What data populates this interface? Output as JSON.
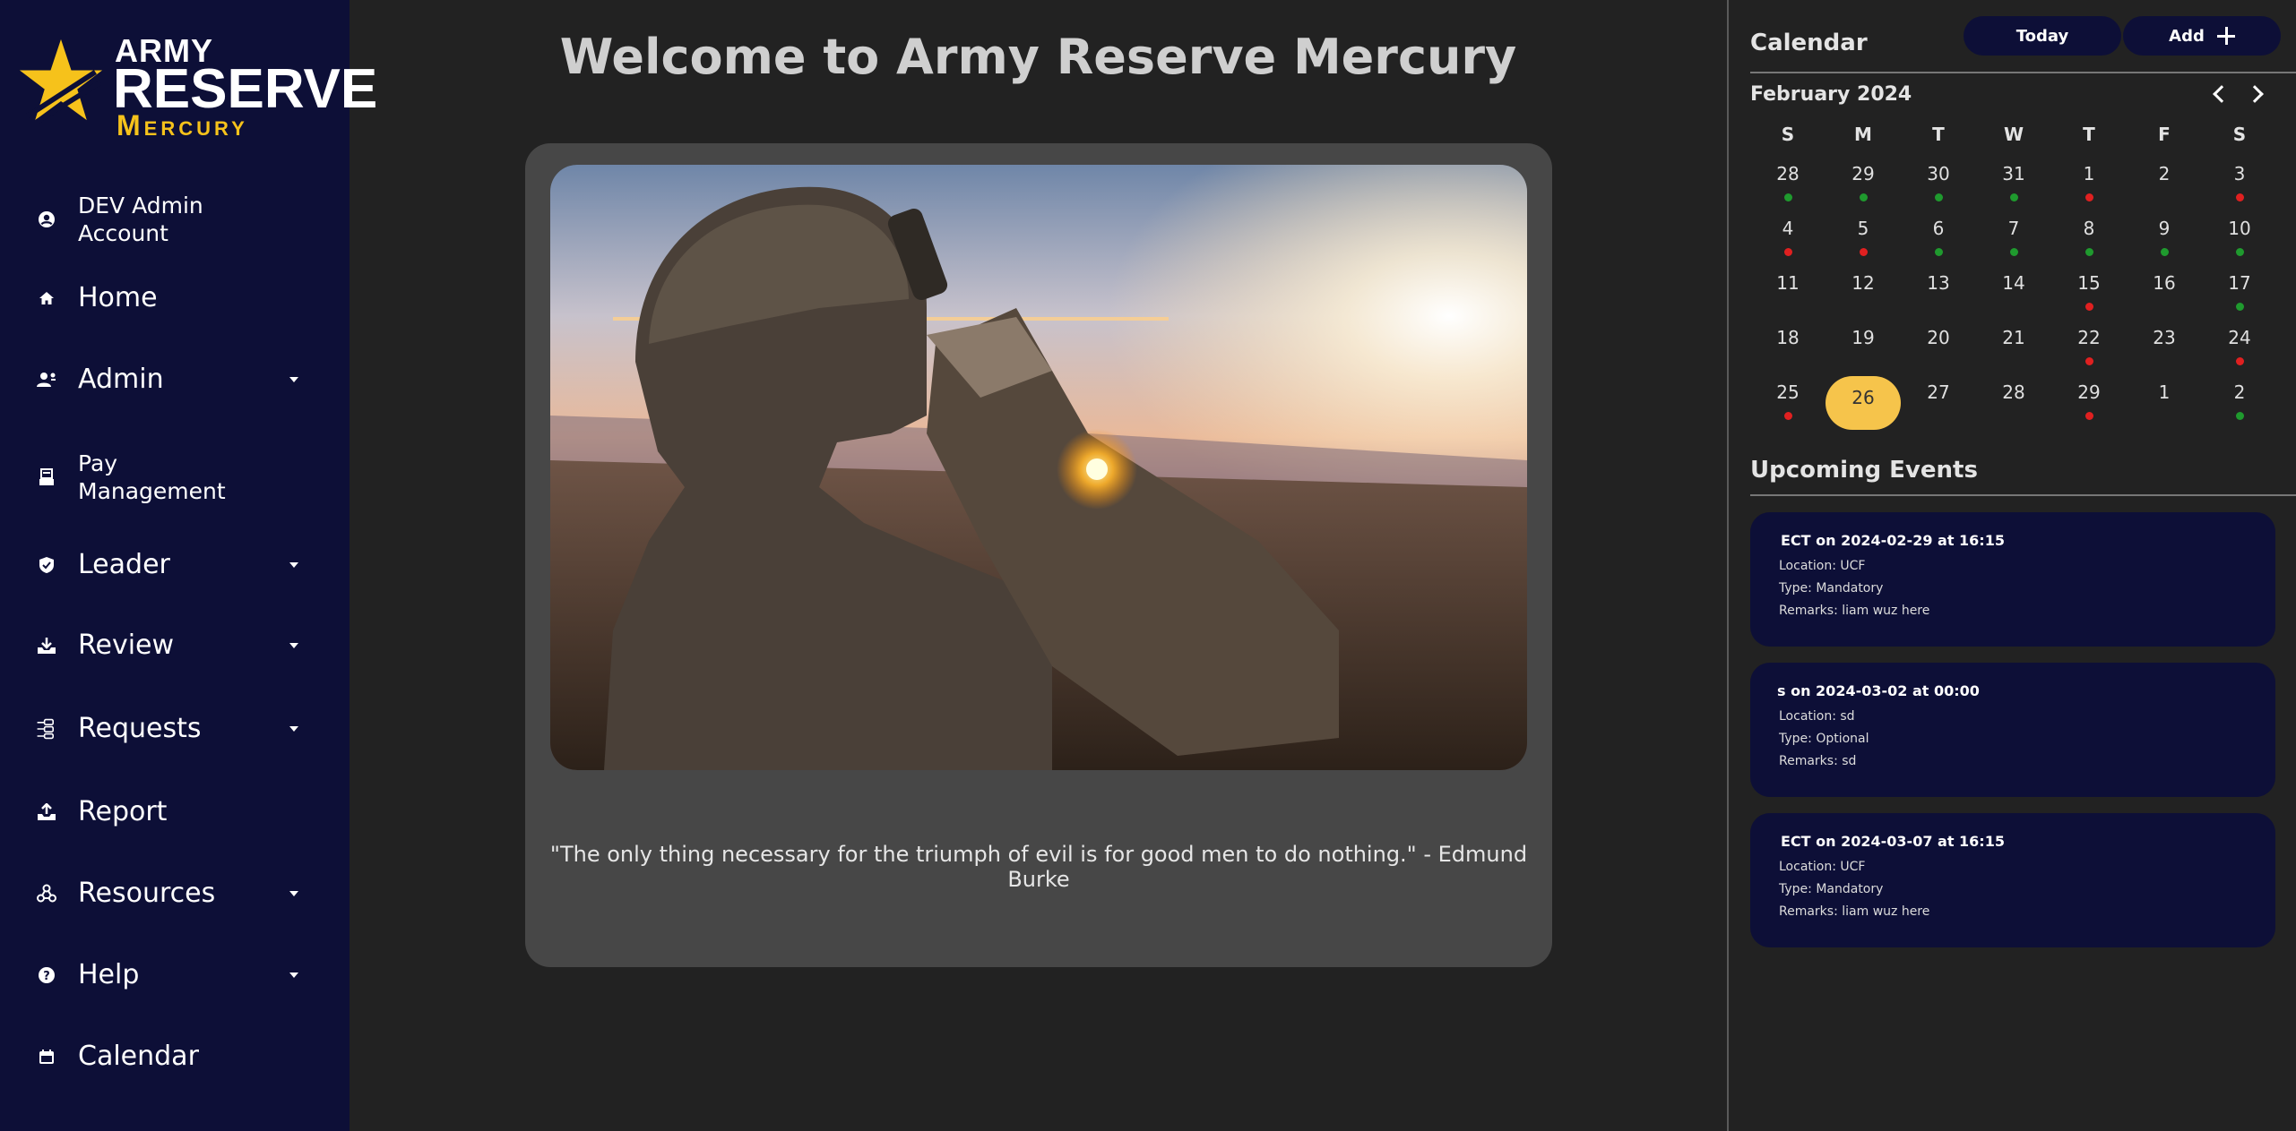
{
  "logo": {
    "line1": "ARMY",
    "line2": "RESERVE",
    "line3": "Mercury"
  },
  "nav": [
    {
      "label": "DEV Admin Account",
      "icon": "account-circle-icon",
      "caret": false
    },
    {
      "label": "Home",
      "icon": "home-icon",
      "caret": false
    },
    {
      "label": "Admin",
      "icon": "admin-users-icon",
      "caret": true
    },
    {
      "label": "Pay Management",
      "icon": "pay-icon",
      "caret": false
    },
    {
      "label": "Leader",
      "icon": "shield-icon",
      "caret": true
    },
    {
      "label": "Review",
      "icon": "download-tray-icon",
      "caret": true
    },
    {
      "label": "Requests",
      "icon": "requests-icon",
      "caret": true
    },
    {
      "label": "Report",
      "icon": "upload-tray-icon",
      "caret": false
    },
    {
      "label": "Resources",
      "icon": "resources-icon",
      "caret": true
    },
    {
      "label": "Help",
      "icon": "help-icon",
      "caret": true
    },
    {
      "label": "Calendar",
      "icon": "calendar-icon",
      "caret": false
    }
  ],
  "main": {
    "title": "Welcome to Army Reserve Mercury",
    "quote": "\"The only thing necessary for the triumph of evil is for good men to do nothing.\" - Edmund Burke"
  },
  "calendar": {
    "title": "Calendar",
    "today_label": "Today",
    "add_label": "Add",
    "month_label": "February 2024",
    "weekdays": [
      "S",
      "M",
      "T",
      "W",
      "T",
      "F",
      "S"
    ],
    "days": [
      {
        "n": "28",
        "dot": "green"
      },
      {
        "n": "29",
        "dot": "green"
      },
      {
        "n": "30",
        "dot": "green"
      },
      {
        "n": "31",
        "dot": "green"
      },
      {
        "n": "1",
        "dot": "red"
      },
      {
        "n": "2",
        "dot": ""
      },
      {
        "n": "3",
        "dot": "red"
      },
      {
        "n": "4",
        "dot": "red"
      },
      {
        "n": "5",
        "dot": "red"
      },
      {
        "n": "6",
        "dot": "green"
      },
      {
        "n": "7",
        "dot": "green"
      },
      {
        "n": "8",
        "dot": "green"
      },
      {
        "n": "9",
        "dot": "green"
      },
      {
        "n": "10",
        "dot": "green"
      },
      {
        "n": "11",
        "dot": ""
      },
      {
        "n": "12",
        "dot": ""
      },
      {
        "n": "13",
        "dot": ""
      },
      {
        "n": "14",
        "dot": ""
      },
      {
        "n": "15",
        "dot": "red"
      },
      {
        "n": "16",
        "dot": ""
      },
      {
        "n": "17",
        "dot": "green"
      },
      {
        "n": "18",
        "dot": ""
      },
      {
        "n": "19",
        "dot": ""
      },
      {
        "n": "20",
        "dot": ""
      },
      {
        "n": "21",
        "dot": ""
      },
      {
        "n": "22",
        "dot": "red"
      },
      {
        "n": "23",
        "dot": ""
      },
      {
        "n": "24",
        "dot": "red"
      },
      {
        "n": "25",
        "dot": "red"
      },
      {
        "n": "26",
        "dot": "",
        "today": true
      },
      {
        "n": "27",
        "dot": ""
      },
      {
        "n": "28",
        "dot": ""
      },
      {
        "n": "29",
        "dot": "red"
      },
      {
        "n": "1",
        "dot": ""
      },
      {
        "n": "2",
        "dot": "green"
      }
    ],
    "colors": {
      "green": "#1f9a2e",
      "red": "#e02020",
      "today": "#f6c44b"
    }
  },
  "upcoming": {
    "title": "Upcoming Events",
    "events": [
      {
        "title": "ECT on 2024-02-29 at 16:15",
        "location": "Location: UCF",
        "type": "Type: Mandatory",
        "remarks": "Remarks: liam wuz here"
      },
      {
        "title": "s on 2024-03-02 at 00:00",
        "location": "Location: sd",
        "type": "Type: Optional",
        "remarks": "Remarks: sd"
      },
      {
        "title": "ECT on 2024-03-07 at 16:15",
        "location": "Location: UCF",
        "type": "Type: Mandatory",
        "remarks": "Remarks: liam wuz here"
      }
    ]
  }
}
